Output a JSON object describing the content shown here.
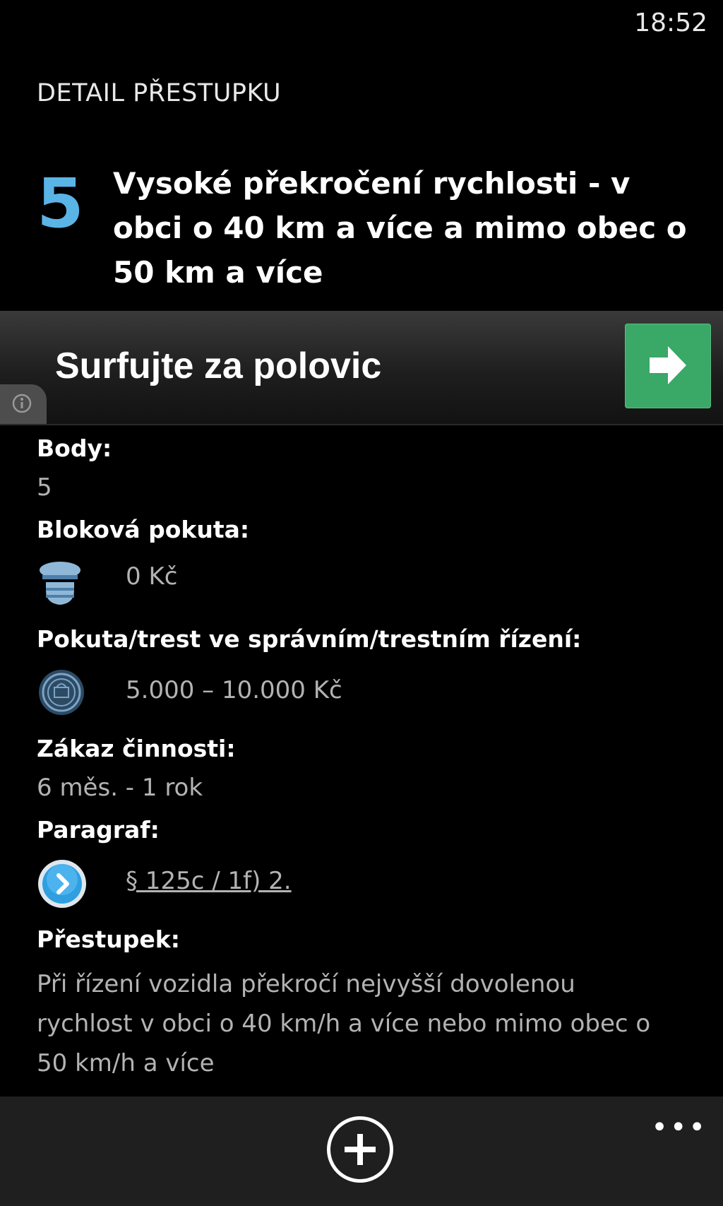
{
  "status_bar": {
    "time": "18:52"
  },
  "page": {
    "title": "DETAIL PŘESTUPKU",
    "points_big": "5",
    "offense_title": "Vysoké překročení rychlosti - v obci o 40 km a více a mimo obec o 50 km a více"
  },
  "ad": {
    "text": "Surfujte za polovic",
    "arrow_icon": "arrow-right-icon",
    "info_icon": "info-icon",
    "arrow_color": "#3aa866"
  },
  "details": {
    "points_label": "Body:",
    "points_value": "5",
    "block_fine_label": "Bloková pokuta:",
    "block_fine_icon": "police-officer-icon",
    "block_fine_value": "0 Kč",
    "admin_fine_label": "Pokuta/trest ve správním/trestním řízení:",
    "admin_fine_icon": "court-seal-icon",
    "admin_fine_value": "5.000 – 10.000 Kč",
    "ban_label": "Zákaz činnosti:",
    "ban_value": "6 měs. - 1 rok",
    "paragraph_label": "Paragraf:",
    "paragraph_icon": "chevron-right-circle-icon",
    "paragraph_value": "§ 125c / 1f) 2.",
    "offense_label": "Přestupek:",
    "offense_text": "Při řízení vozidla překročí nejvyšší dovolenou rychlost v obci o 40 km/h a více nebo mimo obec o 50 km/h a více"
  },
  "app_bar": {
    "add_icon": "plus-icon",
    "more_label": "•••"
  },
  "colors": {
    "accent": "#5ab4e6",
    "background": "#000000",
    "secondary_text": "#b3b3b3"
  }
}
